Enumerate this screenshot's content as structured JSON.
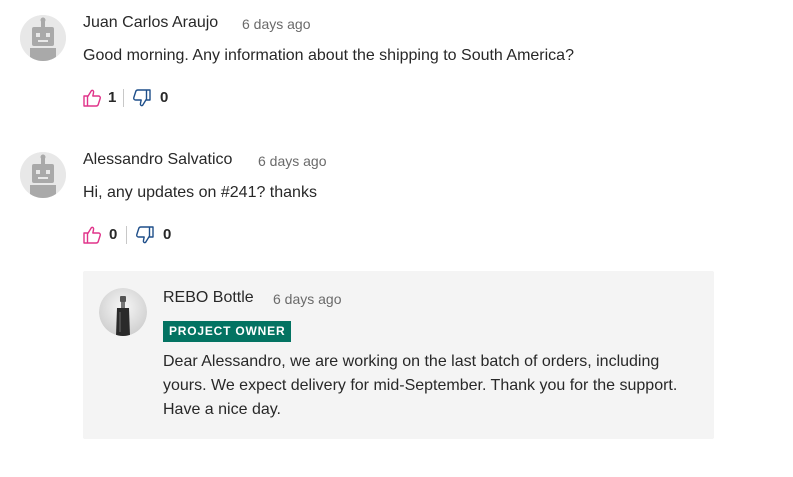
{
  "colors": {
    "like_icon": "#e0338a",
    "dislike_icon": "#1f4f8a",
    "badge_bg": "#037362",
    "reply_bg": "#f4f4f4"
  },
  "comments": [
    {
      "author": "Juan Carlos Araujo",
      "time": "6 days ago",
      "text": "Good morning. Any information about the shipping to South America?",
      "likes": "1",
      "dislikes": "0",
      "avatar_icon": "robot-avatar-icon"
    },
    {
      "author": "Alessandro Salvatico",
      "time": "6 days ago",
      "text": "Hi, any updates on #241? thanks",
      "likes": "0",
      "dislikes": "0",
      "avatar_icon": "robot-avatar-icon"
    }
  ],
  "reply": {
    "author": "REBO Bottle",
    "time": "6 days ago",
    "badge": "PROJECT OWNER",
    "text": "Dear Alessandro, we are working on the last batch of orders, including yours. We expect delivery for mid-September. Thank you for the support. Have a nice day.",
    "avatar_icon": "bottle-avatar-icon"
  }
}
